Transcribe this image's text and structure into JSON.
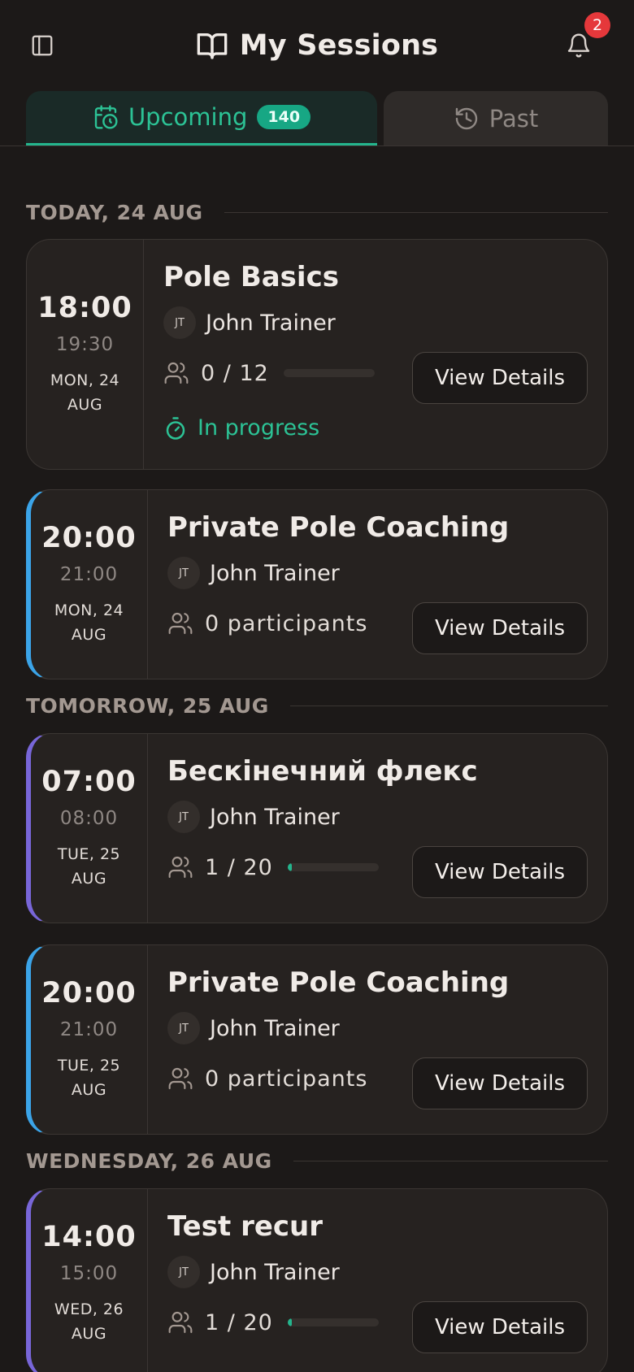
{
  "header": {
    "title": "My Sessions",
    "notification_count": "2"
  },
  "tabs": {
    "upcoming_label": "Upcoming",
    "upcoming_count": "140",
    "past_label": "Past"
  },
  "sections": [
    {
      "title": "TODAY, 24 AUG"
    },
    {
      "title": "TOMORROW, 25 AUG"
    },
    {
      "title": "WEDNESDAY, 26 AUG"
    }
  ],
  "sessions": [
    {
      "start": "18:00",
      "end": "19:30",
      "date": "MON, 24 AUG",
      "title": "Pole Basics",
      "trainer_initials": "JT",
      "trainer": "John Trainer",
      "participants": "0 / 12",
      "fill_fraction": 0.0,
      "status": "In progress",
      "button": "View Details",
      "accent": "none"
    },
    {
      "start": "20:00",
      "end": "21:00",
      "date": "MON, 24 AUG",
      "title": "Private Pole Coaching",
      "trainer_initials": "JT",
      "trainer": "John Trainer",
      "participants": "0 participants",
      "button": "View Details",
      "accent": "#3ba4e8"
    },
    {
      "start": "07:00",
      "end": "08:00",
      "date": "TUE, 25 AUG",
      "title": "Бескінечний флекс",
      "trainer_initials": "JT",
      "trainer": "John Trainer",
      "participants": "1 / 20",
      "fill_fraction": 0.05,
      "button": "View Details",
      "accent": "#7866d8"
    },
    {
      "start": "20:00",
      "end": "21:00",
      "date": "TUE, 25 AUG",
      "title": "Private Pole Coaching",
      "trainer_initials": "JT",
      "trainer": "John Trainer",
      "participants": "0 participants",
      "button": "View Details",
      "accent": "#3ba4e8"
    },
    {
      "start": "14:00",
      "end": "15:00",
      "date": "WED, 26 AUG",
      "title": "Test recur",
      "trainer_initials": "JT",
      "trainer": "John Trainer",
      "participants": "1 / 20",
      "fill_fraction": 0.05,
      "button": "View Details",
      "accent": "#7866d8"
    }
  ],
  "colors": {
    "background": "#1c1918",
    "card": "#262220",
    "accent_green": "#24b58d",
    "badge_red": "#e5383b"
  }
}
